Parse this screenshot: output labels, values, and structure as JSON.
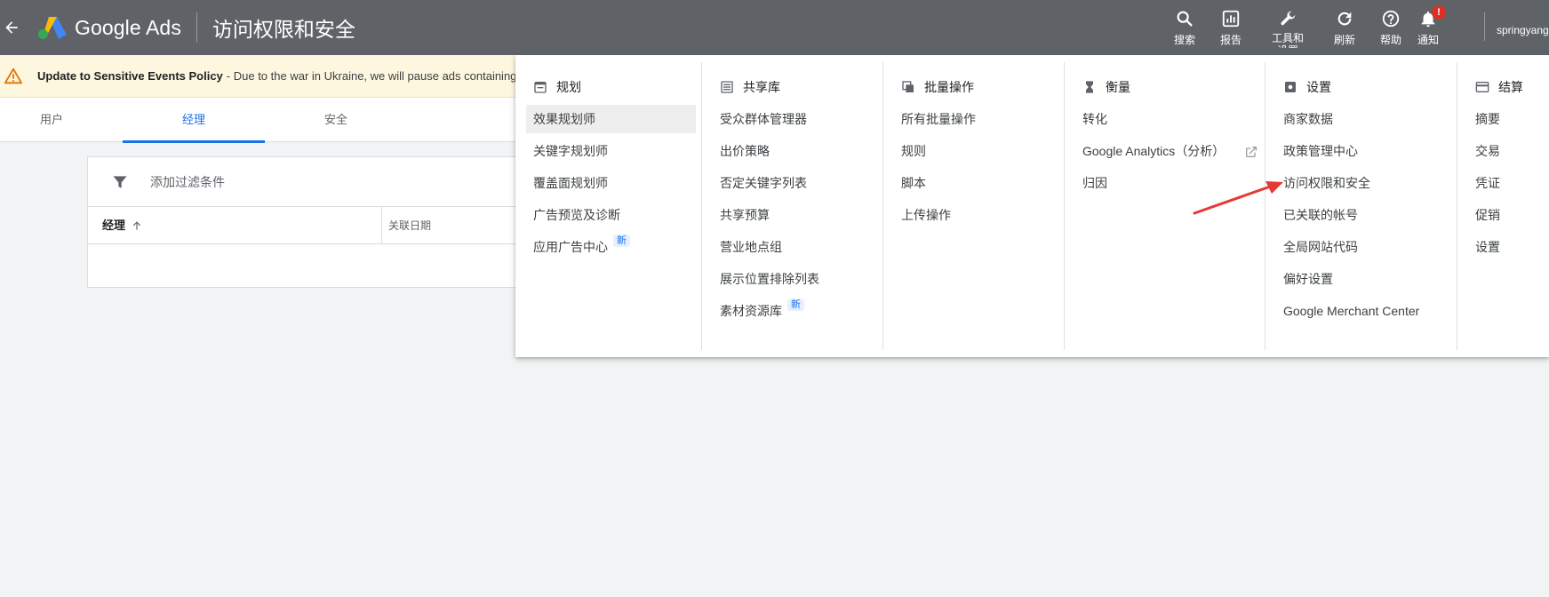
{
  "topbar": {
    "brand": "Google Ads",
    "page_title": "访问权限和安全",
    "tools": [
      {
        "label": "搜索",
        "icon": "search-icon"
      },
      {
        "label": "报告",
        "icon": "report-icon"
      },
      {
        "label": "工具和设置",
        "icon": "wrench-icon"
      },
      {
        "label": "刷新",
        "icon": "refresh-icon"
      },
      {
        "label": "帮助",
        "icon": "help-icon"
      },
      {
        "label": "通知",
        "icon": "bell-icon"
      }
    ],
    "notification_badge": "!",
    "user": "springyang"
  },
  "banner": {
    "title": "Update to Sensitive Events Policy",
    "text": " - Due to the war in Ukraine, we will pause ads containing cor"
  },
  "tabs": [
    {
      "label": "用户"
    },
    {
      "label": "经理"
    },
    {
      "label": "安全"
    }
  ],
  "table": {
    "filter_placeholder": "添加过滤条件",
    "col_manager": "经理",
    "col_date": "关联日期"
  },
  "menu": {
    "new_label": "新",
    "columns": [
      {
        "heading": "规划",
        "icon": "calendar-icon",
        "items": [
          "效果规划师",
          "关键字规划师",
          "覆盖面规划师",
          "广告预览及诊断",
          "应用广告中心"
        ]
      },
      {
        "heading": "共享库",
        "icon": "library-icon",
        "items": [
          "受众群体管理器",
          "出价策略",
          "否定关键字列表",
          "共享预算",
          "营业地点组",
          "展示位置排除列表",
          "素材资源库"
        ]
      },
      {
        "heading": "批量操作",
        "icon": "copy-icon",
        "items": [
          "所有批量操作",
          "规则",
          "脚本",
          "上传操作"
        ]
      },
      {
        "heading": "衡量",
        "icon": "hourglass-icon",
        "items": [
          "转化",
          "Google Analytics（分析）",
          "归因"
        ]
      },
      {
        "heading": "设置",
        "icon": "settings-icon",
        "items": [
          "商家数据",
          "政策管理中心",
          "访问权限和安全",
          "已关联的帐号",
          "全局网站代码",
          "偏好设置",
          "Google Merchant Center"
        ]
      },
      {
        "heading": "结算",
        "icon": "credit-card-icon",
        "items": [
          "摘要",
          "交易",
          "凭证",
          "促销",
          "设置"
        ]
      }
    ]
  },
  "colors": {
    "topbar": "#5f6368",
    "accent": "#1a73e8",
    "warning": "#e37400",
    "annotation": "#e53935"
  }
}
